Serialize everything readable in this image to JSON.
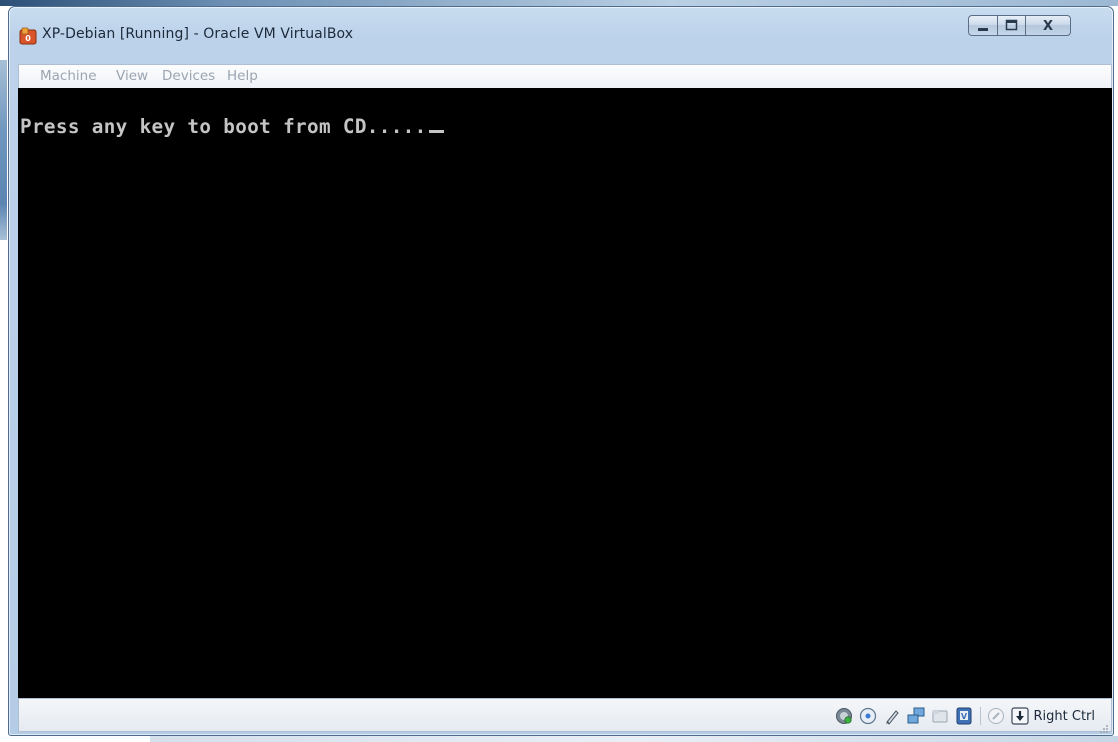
{
  "window": {
    "title": "XP-Debian [Running] - Oracle VM VirtualBox"
  },
  "caption_buttons": {
    "close_glyph": "X"
  },
  "menubar": {
    "items": [
      {
        "label": "Machine"
      },
      {
        "label": "View"
      },
      {
        "label": "Devices"
      },
      {
        "label": "Help"
      }
    ],
    "state": "disabled"
  },
  "console": {
    "text": "Press any key to boot from CD.....",
    "fg_color": "#c4c4c4",
    "bg_color": "#000000"
  },
  "statusbar": {
    "indicators": [
      {
        "name": "hard-disk-icon"
      },
      {
        "name": "optical-drive-icon"
      },
      {
        "name": "usb-icon"
      },
      {
        "name": "network-icon"
      },
      {
        "name": "shared-folders-icon"
      },
      {
        "name": "virtualization-icon"
      },
      {
        "name": "mouse-integration-icon"
      },
      {
        "name": "host-key-arrow-icon"
      }
    ],
    "host_key_label": "Right Ctrl"
  }
}
